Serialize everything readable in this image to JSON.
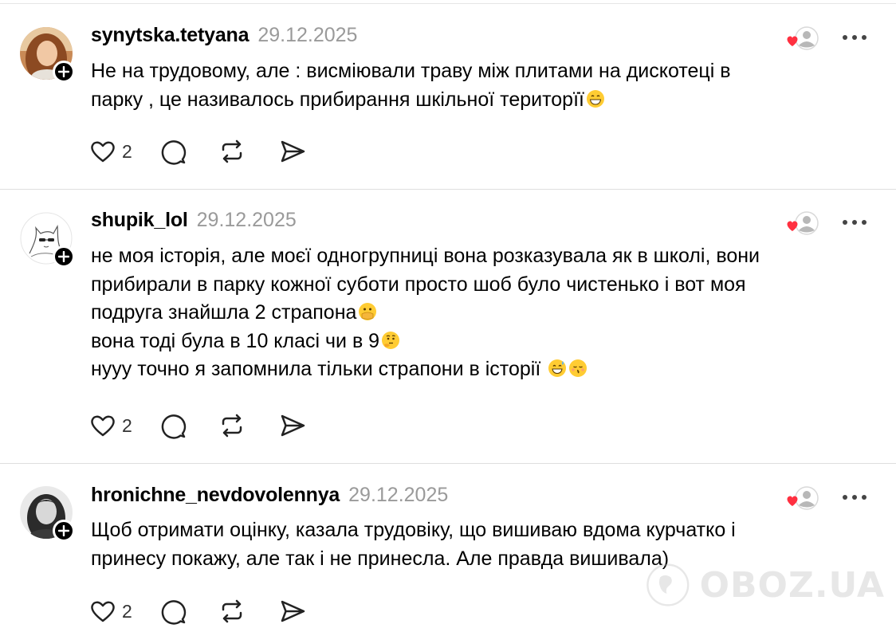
{
  "posts": [
    {
      "username": "synytska.tetyana",
      "date": "29.12.2025",
      "lines": [
        "Не на трудовому, але : висміювали траву між плитами на дискотеці в",
        "парку , це називалось прибирання шкільної територїї"
      ],
      "line_emojis": [
        [],
        [
          "grinning"
        ]
      ],
      "likes": "2",
      "avatar": "photo-woman-auburn-hair"
    },
    {
      "username": "shupik_lol",
      "date": "29.12.2025",
      "lines": [
        "не моя історія, але моєї одногрупниці вона розказувала як в школі, вони",
        "прибирали в парку кожної суботи просто шоб було чистенько і вот моя",
        "подруга знайшла 2 страпона",
        "вона тоді була в 10 класі чи в 9",
        "нууу точно я запомнила тільки страпони в історії "
      ],
      "line_emojis": [
        [],
        [],
        [
          "face-with-hand-over-mouth"
        ],
        [
          "thinking"
        ],
        [
          "sweat-smile",
          "kissing-closed-eyes"
        ]
      ],
      "likes": "2",
      "avatar": "sketch-cat-with-sunglasses"
    },
    {
      "username": "hronichne_nevdovolennya",
      "date": "29.12.2025",
      "lines": [
        "Щоб отримати оцінку, казала трудовіку, що вишиваю вдома курчатко і",
        "принесу покажу, але так і не принесла. Але правда вишивала)"
      ],
      "line_emojis": [
        [],
        []
      ],
      "likes": "2",
      "avatar": "photo-woman-dark-hair-bw"
    }
  ],
  "icons": {
    "like": "heart-icon",
    "reply": "comment-bubble-icon",
    "repost": "repost-icon",
    "share": "send-icon",
    "liked_by": "liked-by-author-icon",
    "more": "more-dots-icon",
    "follow": "plus-icon"
  },
  "colors": {
    "liked_heart": "#ff3040",
    "date": "#9a9a9a",
    "divider": "#dedede"
  },
  "watermark": {
    "text": "OBOZ.UA"
  }
}
